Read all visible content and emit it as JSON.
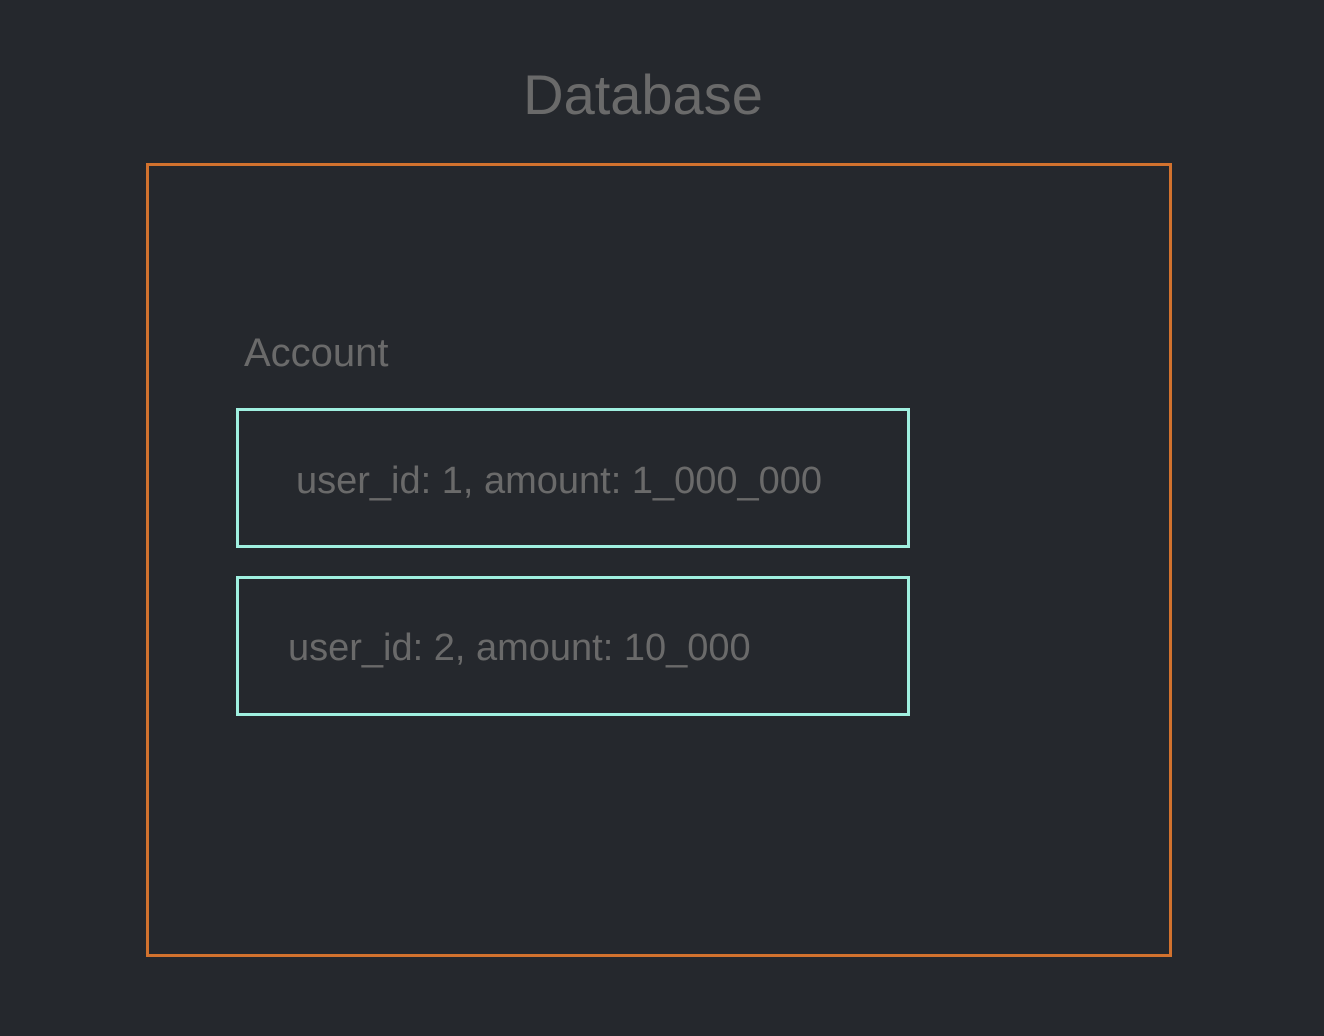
{
  "title": "Database",
  "table": {
    "label": "Account",
    "rows": [
      {
        "text": "user_id: 1, amount: 1_000_000"
      },
      {
        "text": "user_id: 2, amount: 10_000"
      }
    ]
  },
  "colors": {
    "background": "#25282d",
    "database_border": "#d2722e",
    "row_border": "#a0f0e0",
    "text": "#6a6a6a"
  }
}
